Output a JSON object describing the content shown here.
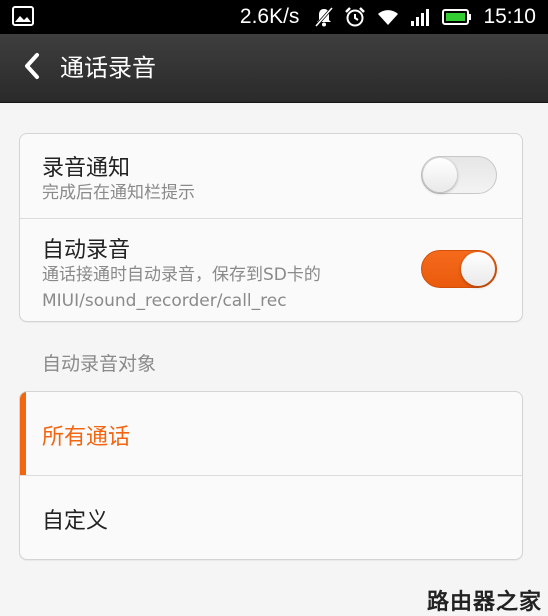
{
  "status_bar": {
    "net_speed": "2.6K/s",
    "time": "15:10",
    "icons": [
      "gallery-icon",
      "mute-icon",
      "alarm-icon",
      "wifi-icon",
      "signal-icon",
      "battery-icon"
    ],
    "battery_color": "#33cc33"
  },
  "header": {
    "title": "通话录音"
  },
  "settings": {
    "record_notify": {
      "title": "录音通知",
      "subtitle": "完成后在通知栏提示",
      "enabled": false
    },
    "auto_record": {
      "title": "自动录音",
      "subtitle_line1": "通话接通时自动录音，保存到SD卡的",
      "subtitle_line2": "MIUI/sound_recorder/call_rec",
      "enabled": true
    }
  },
  "auto_record_target": {
    "header": "自动录音对象",
    "options": [
      {
        "label": "所有通话",
        "selected": true
      },
      {
        "label": "自定义",
        "selected": false
      }
    ]
  },
  "watermark": "路由器之家",
  "colors": {
    "accent": "#f26511",
    "title_bar": "#333333",
    "background": "#f5f5f5"
  }
}
